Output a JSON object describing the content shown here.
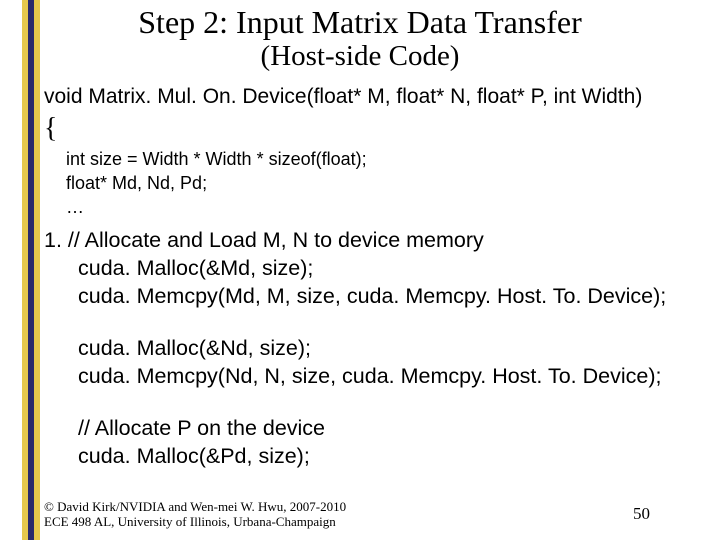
{
  "title": "Step 2: Input Matrix Data Transfer",
  "subtitle": "(Host-side Code)",
  "signature": "void Matrix. Mul. On. Device(float* M, float* N, float* P, int Width)",
  "open_brace": "{",
  "inner": {
    "l1": "int size = Width * Width * sizeof(float);",
    "l2": "float* Md, Nd, Pd;",
    "l3": "…"
  },
  "s1": {
    "a": "1. // Allocate and Load M, N to device memory",
    "b": "cuda. Malloc(&Md, size);",
    "c": "cuda. Memcpy(Md, M, size, cuda. Memcpy. Host. To. Device);"
  },
  "s2": {
    "a": "cuda. Malloc(&Nd, size);",
    "b": "cuda. Memcpy(Nd, N, size, cuda. Memcpy. Host. To. Device);"
  },
  "s3": {
    "a": " // Allocate P on the device",
    "b": "cuda. Malloc(&Pd, size);"
  },
  "footer": {
    "l1": "© David Kirk/NVIDIA and Wen-mei W. Hwu, 2007-2010",
    "l2": "ECE 498 AL, University of Illinois, Urbana-Champaign"
  },
  "page": "50"
}
